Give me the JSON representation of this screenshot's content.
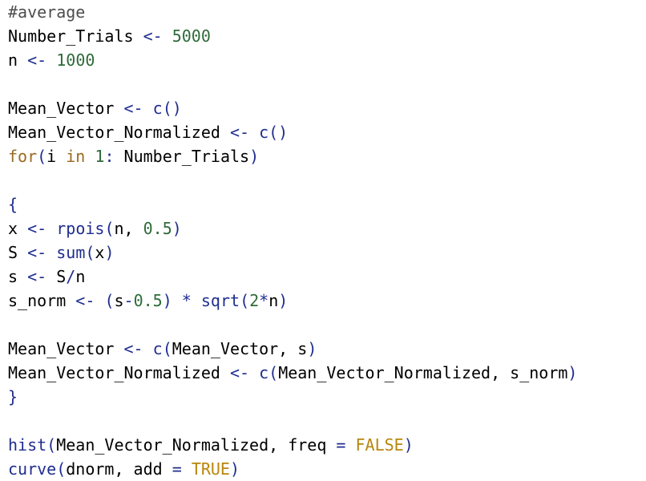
{
  "colors": {
    "background": "#ffffff",
    "comment": "#4d4d4d",
    "identifier": "#000000",
    "operator": "#1f2d8f",
    "number": "#2f6b3a",
    "keyword": "#9a6a1f",
    "function": "#1f2d8f",
    "constant": "#b8860b"
  },
  "code": {
    "lines": [
      [
        {
          "t": "comment",
          "v": "#average"
        }
      ],
      [
        {
          "t": "ident",
          "v": "Number_Trials "
        },
        {
          "t": "operator",
          "v": "<-"
        },
        {
          "t": "ident",
          "v": " "
        },
        {
          "t": "number",
          "v": "5000"
        }
      ],
      [
        {
          "t": "ident",
          "v": "n "
        },
        {
          "t": "operator",
          "v": "<-"
        },
        {
          "t": "ident",
          "v": " "
        },
        {
          "t": "number",
          "v": "1000"
        }
      ],
      [],
      [
        {
          "t": "ident",
          "v": "Mean_Vector "
        },
        {
          "t": "operator",
          "v": "<-"
        },
        {
          "t": "ident",
          "v": " "
        },
        {
          "t": "function",
          "v": "c"
        },
        {
          "t": "paren",
          "v": "()"
        }
      ],
      [
        {
          "t": "ident",
          "v": "Mean_Vector_Normalized "
        },
        {
          "t": "operator",
          "v": "<-"
        },
        {
          "t": "ident",
          "v": " "
        },
        {
          "t": "function",
          "v": "c"
        },
        {
          "t": "paren",
          "v": "()"
        }
      ],
      [
        {
          "t": "keyword",
          "v": "for"
        },
        {
          "t": "paren",
          "v": "("
        },
        {
          "t": "ident",
          "v": "i "
        },
        {
          "t": "keyword",
          "v": "in"
        },
        {
          "t": "ident",
          "v": " "
        },
        {
          "t": "number",
          "v": "1"
        },
        {
          "t": "operator",
          "v": ":"
        },
        {
          "t": "ident",
          "v": " Number_Trials"
        },
        {
          "t": "paren",
          "v": ")"
        }
      ],
      [],
      [
        {
          "t": "paren",
          "v": "{"
        }
      ],
      [
        {
          "t": "ident",
          "v": "x "
        },
        {
          "t": "operator",
          "v": "<-"
        },
        {
          "t": "ident",
          "v": " "
        },
        {
          "t": "function",
          "v": "rpois"
        },
        {
          "t": "paren",
          "v": "("
        },
        {
          "t": "ident",
          "v": "n, "
        },
        {
          "t": "number",
          "v": "0.5"
        },
        {
          "t": "paren",
          "v": ")"
        }
      ],
      [
        {
          "t": "ident",
          "v": "S "
        },
        {
          "t": "operator",
          "v": "<-"
        },
        {
          "t": "ident",
          "v": " "
        },
        {
          "t": "function",
          "v": "sum"
        },
        {
          "t": "paren",
          "v": "("
        },
        {
          "t": "ident",
          "v": "x"
        },
        {
          "t": "paren",
          "v": ")"
        }
      ],
      [
        {
          "t": "ident",
          "v": "s "
        },
        {
          "t": "operator",
          "v": "<-"
        },
        {
          "t": "ident",
          "v": " S"
        },
        {
          "t": "operator",
          "v": "/"
        },
        {
          "t": "ident",
          "v": "n"
        }
      ],
      [
        {
          "t": "ident",
          "v": "s_norm "
        },
        {
          "t": "operator",
          "v": "<-"
        },
        {
          "t": "ident",
          "v": " "
        },
        {
          "t": "paren",
          "v": "("
        },
        {
          "t": "ident",
          "v": "s"
        },
        {
          "t": "operator",
          "v": "-"
        },
        {
          "t": "number",
          "v": "0.5"
        },
        {
          "t": "paren",
          "v": ")"
        },
        {
          "t": "ident",
          "v": " "
        },
        {
          "t": "operator",
          "v": "*"
        },
        {
          "t": "ident",
          "v": " "
        },
        {
          "t": "function",
          "v": "sqrt"
        },
        {
          "t": "paren",
          "v": "("
        },
        {
          "t": "number",
          "v": "2"
        },
        {
          "t": "operator",
          "v": "*"
        },
        {
          "t": "ident",
          "v": "n"
        },
        {
          "t": "paren",
          "v": ")"
        }
      ],
      [],
      [
        {
          "t": "ident",
          "v": "Mean_Vector "
        },
        {
          "t": "operator",
          "v": "<-"
        },
        {
          "t": "ident",
          "v": " "
        },
        {
          "t": "function",
          "v": "c"
        },
        {
          "t": "paren",
          "v": "("
        },
        {
          "t": "ident",
          "v": "Mean_Vector, s"
        },
        {
          "t": "paren",
          "v": ")"
        }
      ],
      [
        {
          "t": "ident",
          "v": "Mean_Vector_Normalized "
        },
        {
          "t": "operator",
          "v": "<-"
        },
        {
          "t": "ident",
          "v": " "
        },
        {
          "t": "function",
          "v": "c"
        },
        {
          "t": "paren",
          "v": "("
        },
        {
          "t": "ident",
          "v": "Mean_Vector_Normalized, s_norm"
        },
        {
          "t": "paren",
          "v": ")"
        }
      ],
      [
        {
          "t": "paren",
          "v": "}"
        }
      ],
      [],
      [
        {
          "t": "function",
          "v": "hist"
        },
        {
          "t": "paren",
          "v": "("
        },
        {
          "t": "ident",
          "v": "Mean_Vector_Normalized, freq "
        },
        {
          "t": "operator",
          "v": "="
        },
        {
          "t": "ident",
          "v": " "
        },
        {
          "t": "constant",
          "v": "FALSE"
        },
        {
          "t": "paren",
          "v": ")"
        }
      ],
      [
        {
          "t": "function",
          "v": "curve"
        },
        {
          "t": "paren",
          "v": "("
        },
        {
          "t": "ident",
          "v": "dnorm, add "
        },
        {
          "t": "operator",
          "v": "="
        },
        {
          "t": "ident",
          "v": " "
        },
        {
          "t": "constant",
          "v": "TRUE"
        },
        {
          "t": "paren",
          "v": ")"
        }
      ]
    ]
  }
}
